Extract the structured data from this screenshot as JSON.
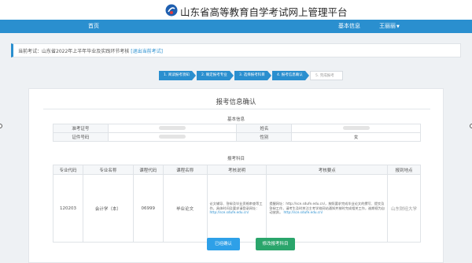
{
  "header": {
    "title": "山东省高等教育自学考试网上管理平台",
    "logo_icon": "sd-exam-logo",
    "brand_colors": {
      "primary": "#2a8fcf",
      "success": "#2aa56b"
    }
  },
  "nav": {
    "home": "首页",
    "info": "基本信息",
    "user": "王丽丽"
  },
  "exam_bar": {
    "label": "当前考试：山东省2022年上半年毕业及实践环节考核",
    "exit_link": "[退出当前考试]"
  },
  "steps": [
    {
      "label": "1. 阅读报考须知",
      "state": "done"
    },
    {
      "label": "2. 确定报考专业",
      "state": "done"
    },
    {
      "label": "3. 选择报考科目",
      "state": "done"
    },
    {
      "label": "4. 报考信息确认",
      "state": "active"
    },
    {
      "label": "5. 完成报考",
      "state": "pending"
    }
  ],
  "card": {
    "title": "报考信息确认",
    "basic_section": "基本信息",
    "basic": {
      "exam_id_label": "准考证号",
      "name_label": "姓名",
      "id_label": "证件号码",
      "gender_label": "性别",
      "gender_value": "女"
    },
    "subject_section": "报考科目",
    "subject_headers": [
      "专业代码",
      "专业名称",
      "课程代码",
      "课程名称",
      "考核说明",
      "考核要点",
      "报到地点"
    ],
    "subject_row": {
      "major_code": "120203",
      "major_name": "会计学（本）",
      "course_code": "06999",
      "course_name": "毕业论文",
      "exam_note": "论文辅导、答辩及毕业资格审查等工作，具体时间及要求请登录网址：",
      "exam_note_link": "http://sce.sdufe.edu.cn/",
      "exam_point": "提醒网址：http://sce.sdufe.edu.cn/，按照要求完成毕业论文的撰写、提交及答辩工作，请考生及时关注主考学校网站通知并按时完成相关工作，逾期视为自动放弃。",
      "exam_point_link": "http://sce.sdufe.edu.cn/",
      "location": "山东财经大学"
    },
    "confirm_button": "已经确认",
    "edit_button": "修改报考科目"
  }
}
